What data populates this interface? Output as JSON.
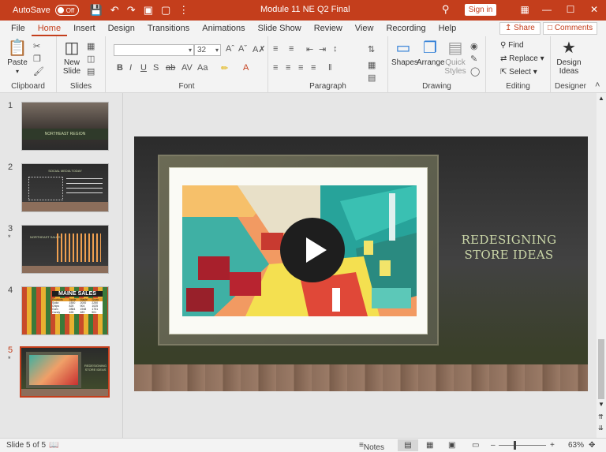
{
  "titlebar": {
    "autosave_label": "AutoSave",
    "autosave_state": "Off",
    "title": "Module 11 NE Q2 Final",
    "signin_label": "Sign in"
  },
  "tabs": [
    {
      "label": "File"
    },
    {
      "label": "Home"
    },
    {
      "label": "Insert"
    },
    {
      "label": "Design"
    },
    {
      "label": "Transitions"
    },
    {
      "label": "Animations"
    },
    {
      "label": "Slide Show"
    },
    {
      "label": "Review"
    },
    {
      "label": "View"
    },
    {
      "label": "Recording"
    },
    {
      "label": "Help"
    }
  ],
  "share_label": "Share",
  "comments_label": "Comments",
  "ribbon": {
    "clipboard": {
      "paste_label": "Paste",
      "group_label": "Clipboard"
    },
    "slides": {
      "new_slide_label": "New Slide",
      "group_label": "Slides"
    },
    "font": {
      "font_size": "32",
      "group_label": "Font"
    },
    "paragraph": {
      "group_label": "Paragraph"
    },
    "drawing": {
      "shapes_label": "Shapes",
      "arrange_label": "Arrange",
      "quick_styles_label": "Quick Styles",
      "group_label": "Drawing"
    },
    "editing": {
      "find_label": "Find",
      "replace_label": "Replace",
      "select_label": "Select",
      "group_label": "Editing"
    },
    "designer": {
      "design_ideas_label": "Design Ideas",
      "group_label": "Designer"
    }
  },
  "thumbnails": [
    {
      "num": "1",
      "star": ""
    },
    {
      "num": "2",
      "star": ""
    },
    {
      "num": "3",
      "star": "*"
    },
    {
      "num": "4",
      "star": ""
    },
    {
      "num": "5",
      "star": "*"
    }
  ],
  "thumb_text": {
    "t1": "NORTHEAST REGION",
    "t2": "SOCIAL MEDIA TODAY",
    "t3": "NORTHEAST SALES",
    "t4": "MAINE SALES",
    "t5": "REDESIGNING STORE IDEAS"
  },
  "maine_table": {
    "headers": [
      "Products",
      "Apple",
      "Maple",
      "Snow"
    ],
    "rows": [
      [
        "Soda",
        "1500",
        "2000",
        "2250"
      ],
      [
        "Chips",
        "825",
        "904",
        "1025"
      ],
      [
        "Gum",
        "2884",
        "1948",
        "1751"
      ],
      [
        "Candy",
        "465",
        "489",
        "501"
      ]
    ]
  },
  "slide": {
    "title_line1": "REDESIGNING",
    "title_line2": "STORE IDEAS"
  },
  "statusbar": {
    "slide_info": "Slide 5 of 5",
    "notes_label": "Notes",
    "zoom": "63%"
  },
  "colors": {
    "accent": "#c43e1c",
    "title_text": "#c9d5a7"
  }
}
